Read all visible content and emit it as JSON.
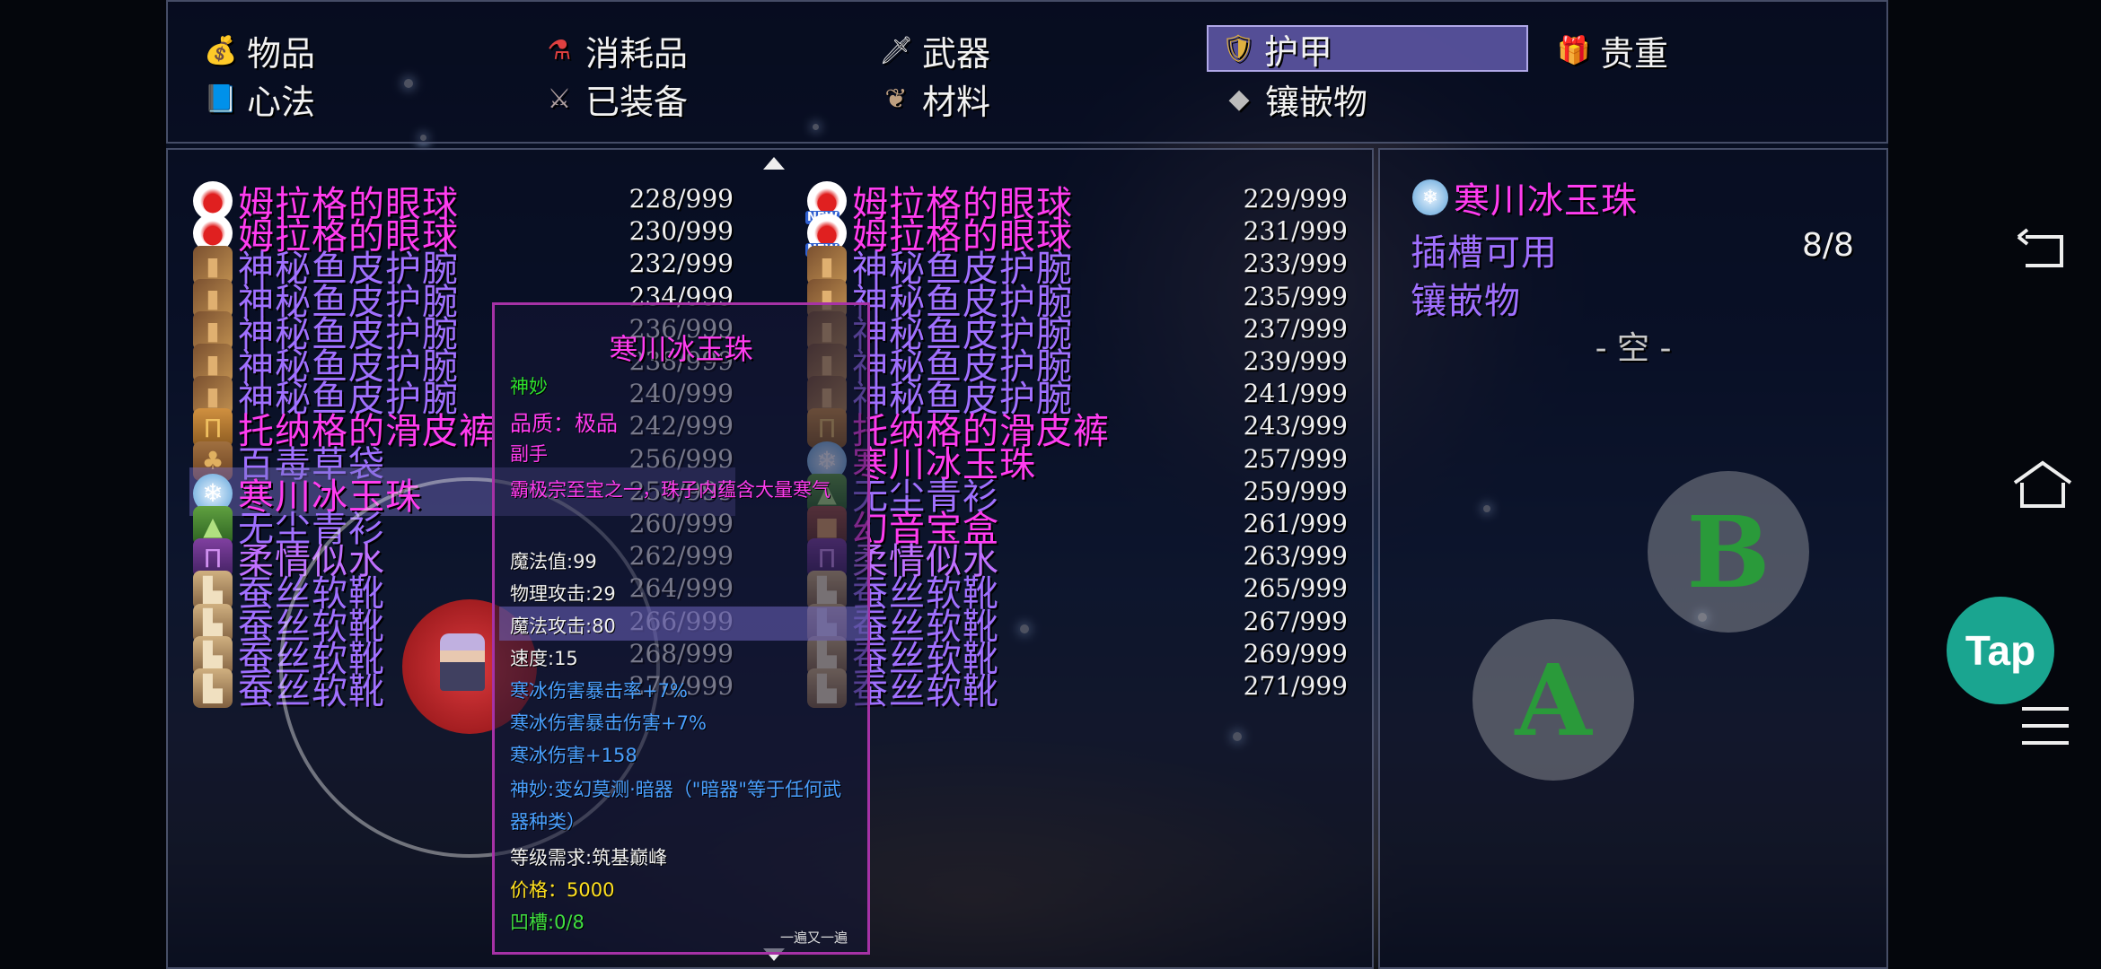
{
  "tabs": [
    {
      "label": "物品",
      "icon": "money-bag-icon",
      "glyph": "💰",
      "selected": false
    },
    {
      "label": "消耗品",
      "icon": "potion-icon",
      "glyph": "🧪",
      "selected": false
    },
    {
      "label": "武器",
      "icon": "sword-icon",
      "glyph": "🗡",
      "selected": false
    },
    {
      "label": "护甲",
      "icon": "shield-icon",
      "glyph": "🛡",
      "selected": true
    },
    {
      "label": "贵重",
      "icon": "treasure-chest-icon",
      "glyph": "🎁",
      "selected": false
    },
    {
      "label": "心法",
      "icon": "book-icon",
      "glyph": "📘",
      "selected": false
    },
    {
      "label": "已装备",
      "icon": "equipped-icon",
      "glyph": "⚔",
      "selected": false
    },
    {
      "label": "材料",
      "icon": "material-icon",
      "glyph": "🪶",
      "selected": false
    },
    {
      "label": "镶嵌物",
      "icon": "gem-stone-icon",
      "glyph": "🪨",
      "selected": false
    }
  ],
  "items": [
    {
      "name": "姆拉格的眼球",
      "count": "228/999",
      "icon": "eyeball-icon",
      "color": "magenta"
    },
    {
      "name": "姆拉格的眼球",
      "count": "229/999",
      "icon": "eyeball-new-icon",
      "color": "magenta",
      "badge": "NEW"
    },
    {
      "name": "姆拉格的眼球",
      "count": "230/999",
      "icon": "eyeball-icon",
      "color": "magenta"
    },
    {
      "name": "姆拉格的眼球",
      "count": "231/999",
      "icon": "eyeball-new-icon",
      "color": "magenta",
      "badge": "NEW"
    },
    {
      "name": "神秘鱼皮护腕",
      "count": "232/999",
      "icon": "bracer-icon",
      "color": "violet"
    },
    {
      "name": "神秘鱼皮护腕",
      "count": "233/999",
      "icon": "bracer-icon",
      "color": "violet"
    },
    {
      "name": "神秘鱼皮护腕",
      "count": "234/999",
      "icon": "bracer-icon",
      "color": "violet"
    },
    {
      "name": "神秘鱼皮护腕",
      "count": "235/999",
      "icon": "bracer-icon",
      "color": "violet"
    },
    {
      "name": "神秘鱼皮护腕",
      "count": "236/999",
      "icon": "bracer-icon",
      "color": "violet"
    },
    {
      "name": "神秘鱼皮护腕",
      "count": "237/999",
      "icon": "bracer-icon",
      "color": "violet"
    },
    {
      "name": "神秘鱼皮护腕",
      "count": "238/999",
      "icon": "bracer-icon",
      "color": "violet"
    },
    {
      "name": "神秘鱼皮护腕",
      "count": "239/999",
      "icon": "bracer-icon",
      "color": "violet"
    },
    {
      "name": "神秘鱼皮护腕",
      "count": "240/999",
      "icon": "bracer-icon",
      "color": "violet"
    },
    {
      "name": "神秘鱼皮护腕",
      "count": "241/999",
      "icon": "bracer-icon",
      "color": "violet"
    },
    {
      "name": "托纳格的滑皮裤",
      "count": "242/999",
      "icon": "leather-pants-icon",
      "color": "magenta"
    },
    {
      "name": "托纳格的滑皮裤",
      "count": "243/999",
      "icon": "leather-pants-icon",
      "color": "magenta"
    },
    {
      "name": "百毒草袋",
      "count": "256/999",
      "icon": "herb-bag-icon",
      "color": "violet"
    },
    {
      "name": "寒川冰玉珠",
      "count": "257/999",
      "icon": "ice-orb-icon",
      "color": "magenta"
    },
    {
      "name": "寒川冰玉珠",
      "count": "258/999",
      "icon": "ice-orb-icon",
      "color": "magenta",
      "selected": true
    },
    {
      "name": "无尘青衫",
      "count": "259/999",
      "icon": "green-robe-icon",
      "color": "violet"
    },
    {
      "name": "无尘青衫",
      "count": "260/999",
      "icon": "green-robe-icon",
      "color": "violet"
    },
    {
      "name": "幻音宝盒",
      "count": "261/999",
      "icon": "treasure-box-icon",
      "color": "magenta"
    },
    {
      "name": "柔情似水",
      "count": "262/999",
      "icon": "purple-garment-icon",
      "color": "purple"
    },
    {
      "name": "柔情似水",
      "count": "263/999",
      "icon": "purple-garment-icon",
      "color": "purple"
    },
    {
      "name": "蚕丝软靴",
      "count": "264/999",
      "icon": "boots-icon",
      "color": "violet"
    },
    {
      "name": "蚕丝软靴",
      "count": "265/999",
      "icon": "boots-icon",
      "color": "violet"
    },
    {
      "name": "蚕丝软靴",
      "count": "266/999",
      "icon": "boots-icon",
      "color": "violet"
    },
    {
      "name": "蚕丝软靴",
      "count": "267/999",
      "icon": "boots-icon",
      "color": "violet"
    },
    {
      "name": "蚕丝软靴",
      "count": "268/999",
      "icon": "boots-icon",
      "color": "violet"
    },
    {
      "name": "蚕丝软靴",
      "count": "269/999",
      "icon": "boots-icon",
      "color": "violet"
    },
    {
      "name": "蚕丝软靴",
      "count": "270/999",
      "icon": "boots-icon",
      "color": "violet"
    },
    {
      "name": "蚕丝软靴",
      "count": "271/999",
      "icon": "boots-icon",
      "color": "violet"
    }
  ],
  "tooltip": {
    "title": "寒川冰玉珠",
    "rarity_tag": "神妙",
    "quality": "品质：极品",
    "slot": "副手",
    "description": "霸极宗至宝之一，珠子内蕴含大量寒气",
    "stats": [
      "魔法值:99",
      "物理攻击:29",
      "魔法攻击:80",
      "速度:15"
    ],
    "bonuses": [
      "寒冰伤害暴击率+7%",
      "寒冰伤害暴击伤害+7%",
      "寒冰伤害+158",
      "神妙:变幻莫测·暗器（\"暗器\"等于任何武器种类）"
    ],
    "requirement": "等级需求:筑基巅峰",
    "price": "价格：5000",
    "sockets": "凹槽:0/8",
    "footer": "一遍又一遍"
  },
  "detail": {
    "item_name": "寒川冰玉珠",
    "slots_label": "插槽可用",
    "slots_value": "8/8",
    "gems_label": "镶嵌物",
    "empty_text": "- 空 -"
  },
  "controls": {
    "b_label": "B",
    "a_label": "A",
    "tap_label": "Tap"
  },
  "colors": {
    "magenta": "#ff3cf0",
    "violet": "#a070ff",
    "purple": "#c070ff",
    "rarity_green": "#2ee02e",
    "bonus_blue": "#4aa0ff",
    "price_yellow": "#ffe020",
    "sockets_green": "#40e040",
    "button_green": "#2a9a3a",
    "tap_teal": "#1aa590"
  }
}
